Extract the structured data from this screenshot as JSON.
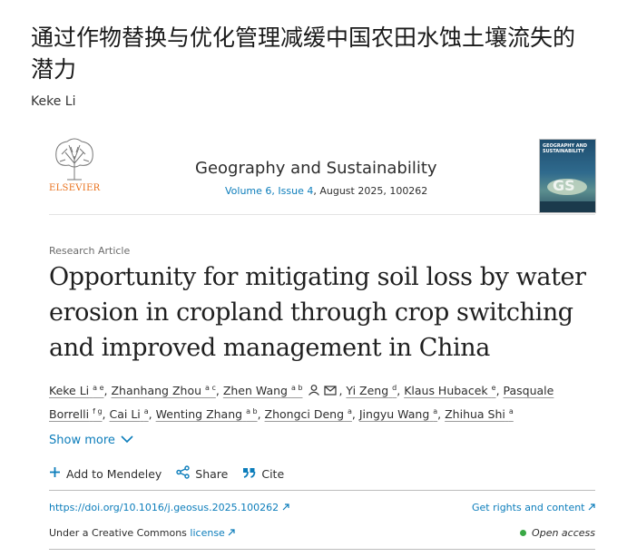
{
  "blog": {
    "title": "通过作物替换与优化管理减缓中国农田水蚀土壤流失的潜力",
    "author": "Keke Li"
  },
  "journal": {
    "publisher": "ELSEVIER",
    "name": "Geography and Sustainability",
    "volume_issue": "Volume 6, Issue 4",
    "date_id": ", August 2025, 100262",
    "cover_title": "GEOGRAPHY AND SUSTAINABILITY"
  },
  "article": {
    "type": "Research Article",
    "title": "Opportunity for mitigating soil loss by water erosion in cropland through crop switching and improved management in China"
  },
  "authors": [
    {
      "name": "Keke Li",
      "aff": "a e"
    },
    {
      "name": "Zhanhang Zhou",
      "aff": "a c"
    },
    {
      "name": "Zhen Wang",
      "aff": "a b"
    },
    {
      "name": "Yi Zeng",
      "aff": "d"
    },
    {
      "name": "Klaus Hubacek",
      "aff": "e"
    },
    {
      "name": "Pasquale Borrelli",
      "aff": "f g"
    },
    {
      "name": "Cai Li",
      "aff": "a"
    },
    {
      "name": "Wenting Zhang",
      "aff": "a b"
    },
    {
      "name": "Zhongci Deng",
      "aff": "a"
    },
    {
      "name": "Jingyu Wang",
      "aff": "a"
    },
    {
      "name": "Zhihua Shi",
      "aff": "a"
    }
  ],
  "show_more": "Show more",
  "actions": {
    "mendeley": "Add to Mendeley",
    "share": "Share",
    "cite": "Cite"
  },
  "links": {
    "doi": "https://doi.org/10.1016/j.geosus.2025.100262",
    "rights": "Get rights and content",
    "license_prefix": "Under a Creative Commons ",
    "license_link": "license",
    "open_access": "Open access"
  },
  "colors": {
    "link": "#0c7dbb",
    "publisher": "#e9711c",
    "open_access": "#39a845"
  },
  "icons": [
    "person-icon",
    "mail-icon",
    "chevron-down-icon",
    "plus-icon",
    "share-icon",
    "quote-icon",
    "external-arrow-icon"
  ]
}
